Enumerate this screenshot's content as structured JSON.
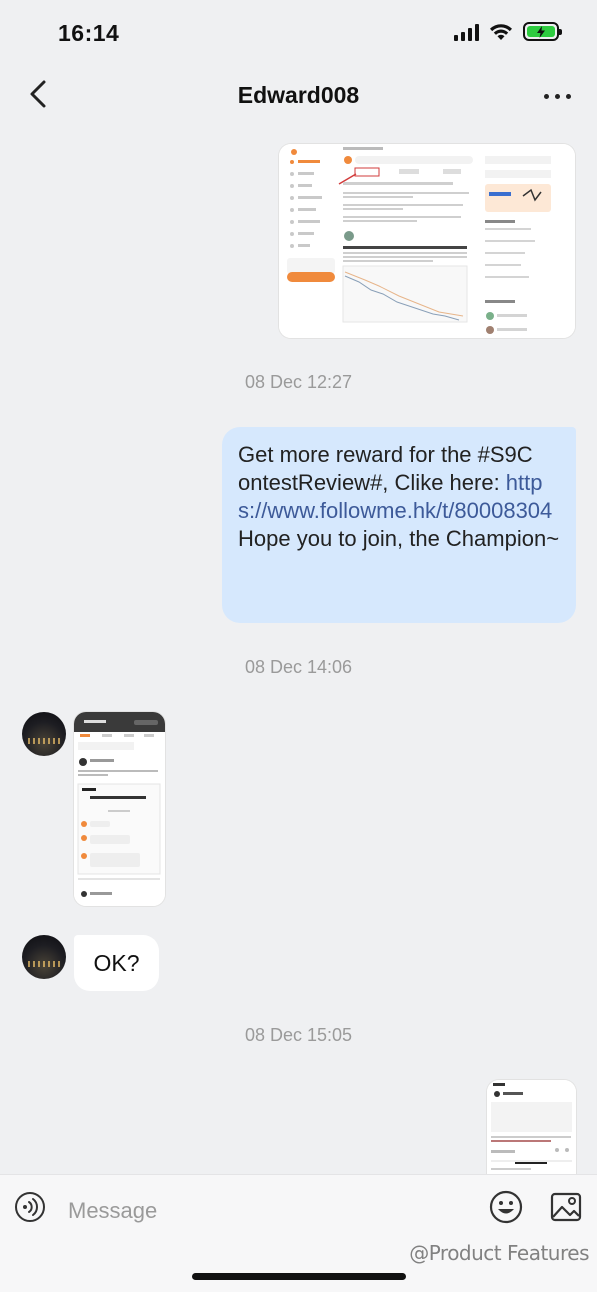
{
  "status": {
    "time": "16:14"
  },
  "header": {
    "title": "Edward008"
  },
  "messages": {
    "timestamps": [
      "08 Dec 12:27",
      "08 Dec 14:06",
      "08 Dec 15:05"
    ],
    "outgoing_text_line1": "Get more reward for the #S9C",
    "outgoing_text_line2": "ontestReview#, Clike here: ",
    "outgoing_link": "https://www.followme.hk/t/80008304",
    "outgoing_text_line5": "Hope you to join, the Champion~",
    "incoming_text": "OK?"
  },
  "composer": {
    "placeholder": "Message"
  },
  "watermark": "@Product Features",
  "colors": {
    "bubble_out": "#d6e8fd",
    "link": "#3d5a99",
    "background": "#eff0f2",
    "accent": "#f08a3c"
  }
}
